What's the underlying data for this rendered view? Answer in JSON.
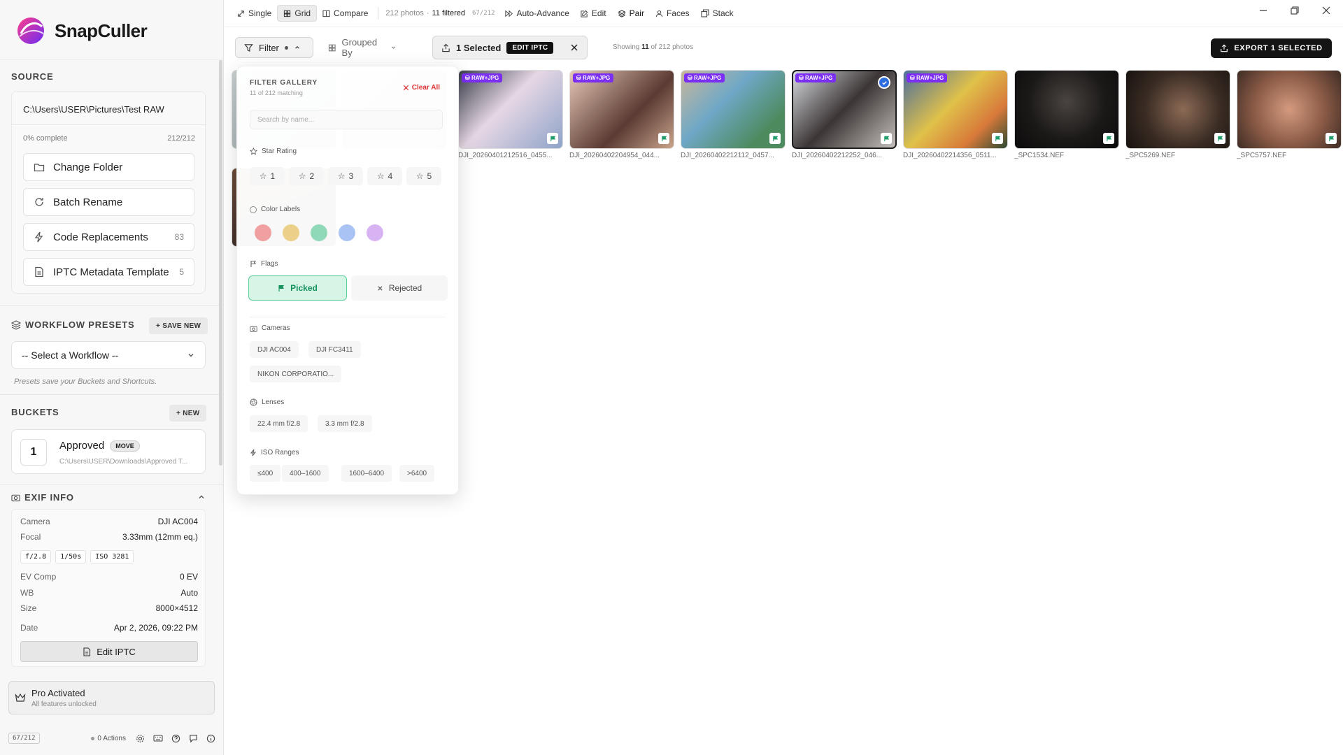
{
  "app": {
    "name": "SnapCuller"
  },
  "source": {
    "title": "SOURCE",
    "path": "C:\\Users\\USER\\Pictures\\Test RAW",
    "progress_label": "0% complete",
    "progress_fraction": 0,
    "count": "212/212",
    "buttons": [
      {
        "label": "Change Folder",
        "icon": "folder-icon",
        "count": ""
      },
      {
        "label": "Batch Rename",
        "icon": "refresh-icon",
        "count": ""
      },
      {
        "label": "Code Replacements",
        "icon": "bolt-icon",
        "count": "83"
      },
      {
        "label": "IPTC Metadata Template",
        "icon": "document-icon",
        "count": "5"
      }
    ]
  },
  "workflow": {
    "title": "WORKFLOW PRESETS",
    "save_label": "+ SAVE NEW",
    "select_value": "-- Select a Workflow --",
    "hint": "Presets save your Buckets and Shortcuts."
  },
  "buckets": {
    "title": "BUCKETS",
    "new_label": "+ NEW",
    "items": [
      {
        "number": "1",
        "name": "Approved",
        "tag": "MOVE",
        "path": "C:\\Users\\USER\\Downloads\\Approved T..."
      }
    ]
  },
  "exif": {
    "title": "EXIF INFO",
    "camera_label": "Camera",
    "camera": "DJI AC004",
    "focal_label": "Focal",
    "focal": "3.33mm (12mm eq.)",
    "aperture": "f/2.8",
    "shutter": "1/50s",
    "iso": "ISO 3281",
    "ev_label": "EV Comp",
    "ev": "0 EV",
    "wb_label": "WB",
    "wb": "Auto",
    "size_label": "Size",
    "size": "8000×4512",
    "date_label": "Date",
    "date": "Apr 2, 2026, 09:22 PM",
    "edit_label": "Edit IPTC"
  },
  "pro": {
    "title": "Pro Activated",
    "subtitle": "All features unlocked"
  },
  "footer": {
    "count": "67/212",
    "actions": "0 Actions"
  },
  "topbar": {
    "views": [
      "Single",
      "Grid",
      "Compare"
    ],
    "active_view": "Grid",
    "photos_count": "212 photos",
    "separator": "·",
    "filtered": "11 filtered",
    "position": "67/212",
    "actions": [
      "Auto-Advance",
      "Edit",
      "Pair",
      "Faces",
      "Stack"
    ]
  },
  "toolbar": {
    "filter_label": "Filter",
    "grouped_label": "Grouped By",
    "selected_label": "1 Selected",
    "edit_iptc_label": "EDIT IPTC",
    "showing_prefix": "Showing",
    "showing_count": "11",
    "showing_suffix": "of 212 photos",
    "export_label": "EXPORT 1 SELECTED"
  },
  "photos": [
    {
      "name": "DJI_20260401212516_0455...",
      "badge": "RAW+JPG",
      "selected": false
    },
    {
      "name": "DJI_20260402204954_044...",
      "badge": "RAW+JPG",
      "selected": false
    },
    {
      "name": "DJI_20260402212112_0457...",
      "badge": "RAW+JPG",
      "selected": false
    },
    {
      "name": "DJI_20260402212252_046...",
      "badge": "RAW+JPG",
      "selected": true
    },
    {
      "name": "DJI_20260402214356_0511...",
      "badge": "RAW+JPG",
      "selected": false
    },
    {
      "name": "_SPC1534.NEF",
      "badge": "",
      "selected": false
    },
    {
      "name": "_SPC5269.NEF",
      "badge": "",
      "selected": false
    },
    {
      "name": "_SPC5757.NEF",
      "badge": "",
      "selected": false
    }
  ],
  "filter_panel": {
    "title": "FILTER GALLERY",
    "subtitle": "11 of 212 matching",
    "clear_label": "Clear All",
    "search_placeholder": "Search by name...",
    "star_title": "Star Rating",
    "stars": [
      "1",
      "2",
      "3",
      "4",
      "5"
    ],
    "color_title": "Color Labels",
    "colors": [
      "#f0a0a0",
      "#ecd08a",
      "#8fd9b8",
      "#a9c3f5",
      "#d7b3f3"
    ],
    "flags_title": "Flags",
    "picked_label": "Picked",
    "rejected_label": "Rejected",
    "cameras_title": "Cameras",
    "cameras": [
      "DJI AC004",
      "DJI FC3411",
      "NIKON CORPORATIO..."
    ],
    "lenses_title": "Lenses",
    "lenses": [
      "22.4 mm f/2.8",
      "3.3 mm f/2.8"
    ],
    "iso_title": "ISO Ranges",
    "iso": [
      "≤400",
      "400–1600",
      "1600–6400",
      ">6400"
    ]
  }
}
